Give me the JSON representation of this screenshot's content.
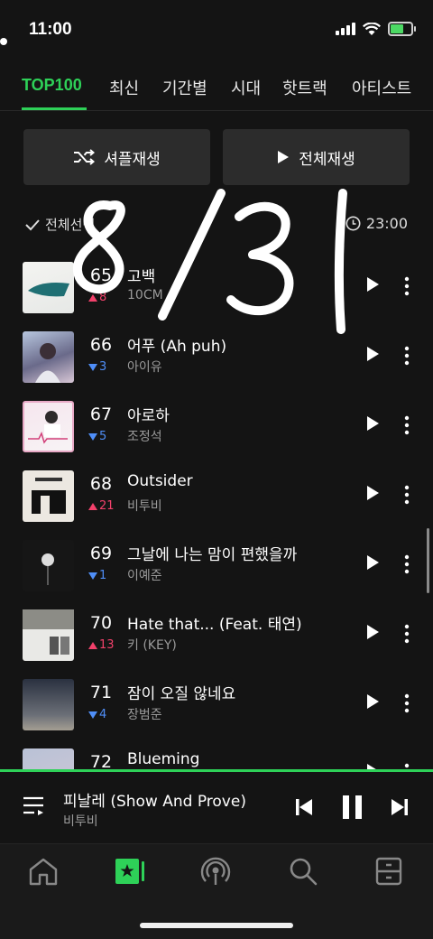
{
  "status": {
    "time": "11:00"
  },
  "tabs": [
    "TOP100",
    "최신",
    "기간별",
    "시대",
    "핫트랙",
    "아티스트"
  ],
  "actions": {
    "shuffle": "셔플재생",
    "play_all": "전체재생"
  },
  "list_header": {
    "select_all": "전체선택",
    "duration": "23:00"
  },
  "songs": [
    {
      "rank": "65",
      "title": "고백",
      "artist": "10CM",
      "change": "8",
      "dir": "up"
    },
    {
      "rank": "66",
      "title": "어푸 (Ah puh)",
      "artist": "아이유",
      "change": "3",
      "dir": "down"
    },
    {
      "rank": "67",
      "title": "아로하",
      "artist": "조정석",
      "change": "5",
      "dir": "down"
    },
    {
      "rank": "68",
      "title": "Outsider",
      "artist": "비투비",
      "change": "21",
      "dir": "up"
    },
    {
      "rank": "69",
      "title": "그날에 나는 맘이 편했을까",
      "artist": "이예준",
      "change": "1",
      "dir": "down"
    },
    {
      "rank": "70",
      "title": "Hate that... (Feat. 태연)",
      "artist": "키 (KEY)",
      "change": "13",
      "dir": "up"
    },
    {
      "rank": "71",
      "title": "잠이 오질 않네요",
      "artist": "장범준",
      "change": "4",
      "dir": "down"
    },
    {
      "rank": "72",
      "title": "Blueming",
      "artist": "",
      "change": "",
      "dir": ""
    }
  ],
  "overlay_text": "8/31",
  "now_playing": {
    "title": "피날레 (Show And Prove)",
    "artist": "비투비"
  },
  "colors": {
    "accent": "#2ed158",
    "up": "#f2416b",
    "down": "#4f8ef7",
    "background": "#141414"
  },
  "nav_icons": [
    "home-icon",
    "my-music-icon",
    "podcast-icon",
    "search-icon",
    "menu-icon"
  ]
}
